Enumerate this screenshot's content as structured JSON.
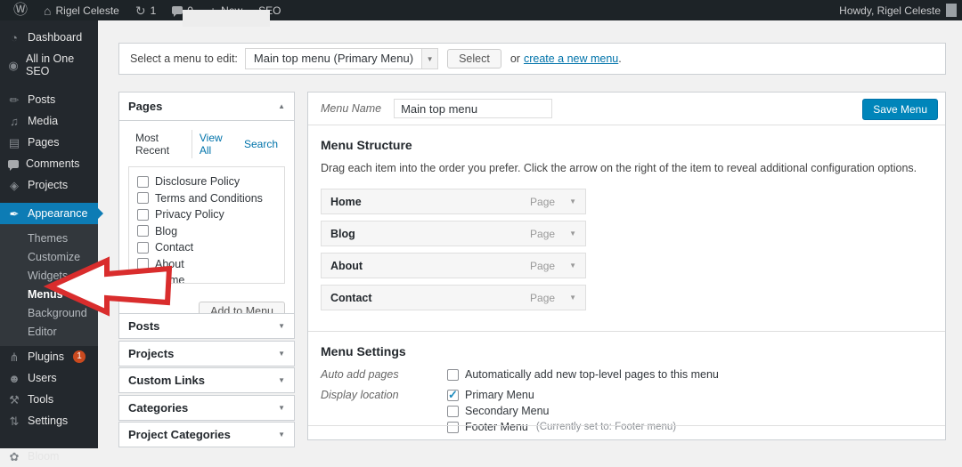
{
  "admin_bar": {
    "site_name": "Rigel Celeste",
    "updates_count": "1",
    "comments_count": "0",
    "new_label": "New",
    "seo_label": "SEO",
    "howdy": "Howdy, Rigel Celeste"
  },
  "sidebar": {
    "items": [
      {
        "label": "Dashboard"
      },
      {
        "label": "All in One SEO"
      },
      {
        "label": "Posts"
      },
      {
        "label": "Media"
      },
      {
        "label": "Pages"
      },
      {
        "label": "Comments"
      },
      {
        "label": "Projects"
      },
      {
        "label": "Appearance"
      },
      {
        "label": "Plugins"
      },
      {
        "label": "Users"
      },
      {
        "label": "Tools"
      },
      {
        "label": "Settings"
      },
      {
        "label": "Bloom"
      }
    ],
    "plugins_badge": "1",
    "appearance_submenu": [
      {
        "label": "Themes"
      },
      {
        "label": "Customize"
      },
      {
        "label": "Widgets"
      },
      {
        "label": "Menus"
      },
      {
        "label": "Background"
      },
      {
        "label": "Editor"
      }
    ],
    "current_submenu": "Menus"
  },
  "menu_select": {
    "label": "Select a menu to edit:",
    "dropdown_value": "Main top menu (Primary Menu)",
    "select_button": "Select",
    "or_text": "or",
    "create_link": "create a new menu",
    "period": "."
  },
  "pages_panel": {
    "title": "Pages",
    "tabs": [
      {
        "label": "Most Recent"
      },
      {
        "label": "View All"
      },
      {
        "label": "Search"
      }
    ],
    "active_tab": "Most Recent",
    "items": [
      {
        "label": "Disclosure Policy",
        "checked": false
      },
      {
        "label": "Terms and Conditions",
        "checked": false
      },
      {
        "label": "Privacy Policy",
        "checked": false
      },
      {
        "label": "Blog",
        "checked": false
      },
      {
        "label": "Contact",
        "checked": false
      },
      {
        "label": "About",
        "checked": false
      },
      {
        "label": "Home",
        "checked": false
      }
    ],
    "add_button": "Add to Menu"
  },
  "accordions": [
    {
      "label": "Posts"
    },
    {
      "label": "Projects"
    },
    {
      "label": "Custom Links"
    },
    {
      "label": "Categories"
    },
    {
      "label": "Project Categories"
    }
  ],
  "editor": {
    "menu_name_label": "Menu Name",
    "menu_name_value": "Main top menu",
    "save_button": "Save Menu",
    "structure_title": "Menu Structure",
    "structure_desc": "Drag each item into the order you prefer. Click the arrow on the right of the item to reveal additional configuration options.",
    "items": [
      {
        "label": "Home",
        "type": "Page"
      },
      {
        "label": "Blog",
        "type": "Page"
      },
      {
        "label": "About",
        "type": "Page"
      },
      {
        "label": "Contact",
        "type": "Page"
      }
    ],
    "settings_title": "Menu Settings",
    "auto_add_label": "Auto add pages",
    "auto_add_text": "Automatically add new top-level pages to this menu",
    "display_label": "Display location",
    "locations": [
      {
        "label": "Primary Menu",
        "checked": true,
        "note": ""
      },
      {
        "label": "Secondary Menu",
        "checked": false,
        "note": ""
      },
      {
        "label": "Footer Menu",
        "checked": false,
        "note": "(Currently set to: Footer menu)"
      }
    ]
  },
  "icons": {
    "wordpress": "Ⓦ",
    "home": "⌂",
    "updates": "↻",
    "plus": "+",
    "dashboard": "◔",
    "seo_shield": "◉",
    "posts_pin": "✏",
    "media": "♫",
    "pages": "▤",
    "projects": "◈",
    "appearance": "✒",
    "plugins": "⋔",
    "users": "☻",
    "tools": "⚒",
    "settings": "⇅",
    "bloom": "✿",
    "caret_up": "▲",
    "caret_down": "▼",
    "select_caret": "▼"
  },
  "colors": {
    "accent_blue": "#0073aa",
    "active_item_blue": "#0d7cb5",
    "button_blue": "#0085ba",
    "badge_red": "#ca4a1f",
    "arrow_red": "#d92d2d",
    "admin_bar_bg": "#1d2327",
    "sidebar_bg": "#23282d"
  }
}
